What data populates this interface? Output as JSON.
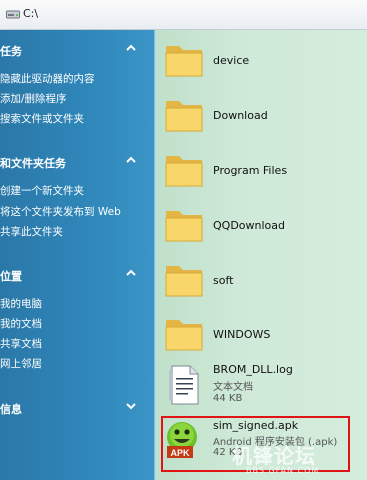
{
  "address": {
    "path": "C:\\",
    "icon": "drive-icon"
  },
  "task_pane": {
    "sections": [
      {
        "title": "任务",
        "links": [
          "隐藏此驱动器的内容",
          "添加/删除程序",
          "搜索文件或文件夹"
        ]
      },
      {
        "title": "和文件夹任务",
        "links": [
          "创建一个新文件夹",
          "将这个文件夹发布到 Web",
          "共享此文件夹"
        ]
      },
      {
        "title": "位置",
        "links": [
          "我的电脑",
          "我的文档",
          "共享文档",
          "网上邻居"
        ]
      },
      {
        "title": "信息",
        "links": []
      }
    ]
  },
  "files": [
    {
      "name": "device",
      "type": "folder"
    },
    {
      "name": "Download",
      "type": "folder"
    },
    {
      "name": "Program Files",
      "type": "folder"
    },
    {
      "name": "QQDownload",
      "type": "folder"
    },
    {
      "name": "soft",
      "type": "folder"
    },
    {
      "name": "WINDOWS",
      "type": "folder"
    },
    {
      "name": "BROM_DLL.log",
      "type": "log",
      "kind": "文本文档",
      "size": "44 KB"
    },
    {
      "name": "sim_signed.apk",
      "type": "apk",
      "kind": "Android 程序安装包 (.apk)",
      "size": "42 KB",
      "icon_label": "APK"
    }
  ],
  "watermark": {
    "text": "机锋论坛",
    "url": "BBS.GFAN.COM"
  },
  "colors": {
    "pane": "#2f86b9",
    "content": "#cfe9d8",
    "highlight": "#e01414"
  }
}
